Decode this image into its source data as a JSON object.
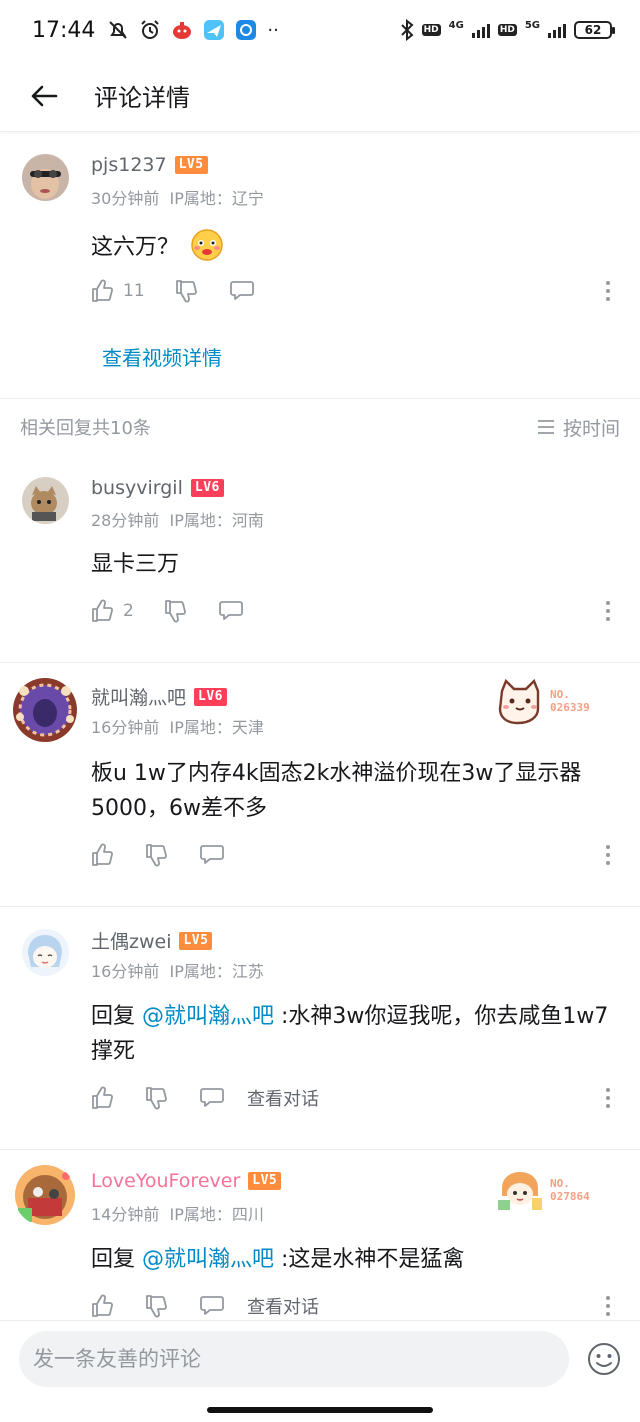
{
  "status_bar": {
    "time": "17:44",
    "net1": "4G",
    "net2": "5G",
    "hd": "HD",
    "battery": "62"
  },
  "header": {
    "title": "评论详情"
  },
  "root_comment": {
    "username": "pjs1237",
    "level": "LV5",
    "time": "30分钟前",
    "ip": "IP属地：辽宁",
    "text": "这六万？",
    "likes": "11",
    "view_video": "查看视频详情"
  },
  "replies_header": {
    "count_label": "相关回复共10条",
    "sort_label": "按时间"
  },
  "replies": [
    {
      "username": "busyvirgil",
      "level": "LV6",
      "time": "28分钟前",
      "ip": "IP属地：河南",
      "text": "显卡三万",
      "likes": "2"
    },
    {
      "username": "就叫瀚灬吧",
      "level": "LV6",
      "time": "16分钟前",
      "ip": "IP属地：天津",
      "text": "板u 1w了内存4k固态2k水神溢价现在3w了显示器5000，6w差不多",
      "fan_prefix": "NO.",
      "fan_number": "026339"
    },
    {
      "username": "土偶zwei",
      "level": "LV5",
      "time": "16分钟前",
      "ip": "IP属地：江苏",
      "reply_prefix": "回复 ",
      "mention": "@就叫瀚灬吧",
      "text": " :水神3w你逗我呢，你去咸鱼1w7撑死",
      "view_dialog": "查看对话"
    },
    {
      "username": "LoveYouForever",
      "level": "LV5",
      "time": "14分钟前",
      "ip": "IP属地：四川",
      "reply_prefix": "回复 ",
      "mention": "@就叫瀚灬吧",
      "text": " :这是水神不是猛禽",
      "view_dialog": "查看对话",
      "fan_prefix": "NO.",
      "fan_number": "027864"
    }
  ],
  "input": {
    "placeholder": "发一条友善的评论"
  },
  "colors": {
    "link": "#008ac5",
    "lv5": "#ff8c3d",
    "lv6": "#ff3f5a",
    "vip_name": "#fb7299",
    "secondary_text": "#9499a0"
  }
}
